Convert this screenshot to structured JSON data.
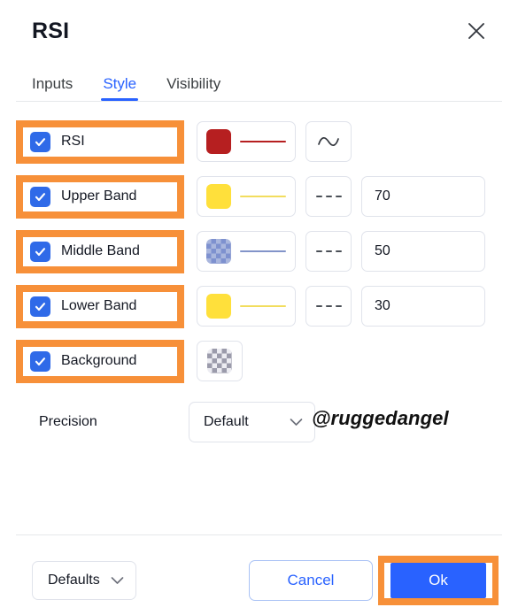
{
  "header": {
    "title": "RSI",
    "close_icon": "close-icon"
  },
  "tabs": [
    {
      "label": "Inputs",
      "active": false
    },
    {
      "label": "Style",
      "active": true
    },
    {
      "label": "Visibility",
      "active": false
    }
  ],
  "style_rows": [
    {
      "id": "rsi",
      "label": "RSI",
      "checked": true,
      "highlighted": true,
      "color": "#b61f20",
      "color_type": "solid",
      "line_color": "#b61f20",
      "line_style_icon": "wave-icon",
      "has_value": false,
      "value": ""
    },
    {
      "id": "upper-band",
      "label": "Upper Band",
      "checked": true,
      "highlighted": true,
      "color": "#ffe03b",
      "color_type": "solid",
      "line_color": "#f2dd5e",
      "line_style_icon": "dashed-line-icon",
      "has_value": true,
      "value": "70"
    },
    {
      "id": "middle-band",
      "label": "Middle Band",
      "checked": true,
      "highlighted": true,
      "color": "#7e91cf",
      "color_alt": "#a9b6dd",
      "color_type": "checker",
      "line_color": "#8294c9",
      "line_style_icon": "dashed-line-icon",
      "has_value": true,
      "value": "50"
    },
    {
      "id": "lower-band",
      "label": "Lower Band",
      "checked": true,
      "highlighted": true,
      "color": "#ffe03b",
      "color_type": "solid",
      "line_color": "#f2dd5e",
      "line_style_icon": "dashed-line-icon",
      "has_value": true,
      "value": "30"
    },
    {
      "id": "background",
      "label": "Background",
      "checked": true,
      "highlighted": true,
      "color": "#9b9bab",
      "color_alt": "#ececf2",
      "color_type": "checker",
      "line_color": "",
      "line_style_icon": "",
      "has_value": false,
      "value": ""
    }
  ],
  "precision": {
    "label": "Precision",
    "value": "Default",
    "chevron_icon": "chevron-down-icon"
  },
  "watermark": {
    "text": "@ruggedangel"
  },
  "footer": {
    "defaults_label": "Defaults",
    "defaults_chevron_icon": "chevron-down-icon",
    "cancel_label": "Cancel",
    "ok_label": "Ok"
  },
  "colors": {
    "accent_blue": "#2962ff",
    "checkbox_blue": "#2f6ae8",
    "highlight_orange": "#f79039",
    "border_gray": "#e0e3eb"
  }
}
